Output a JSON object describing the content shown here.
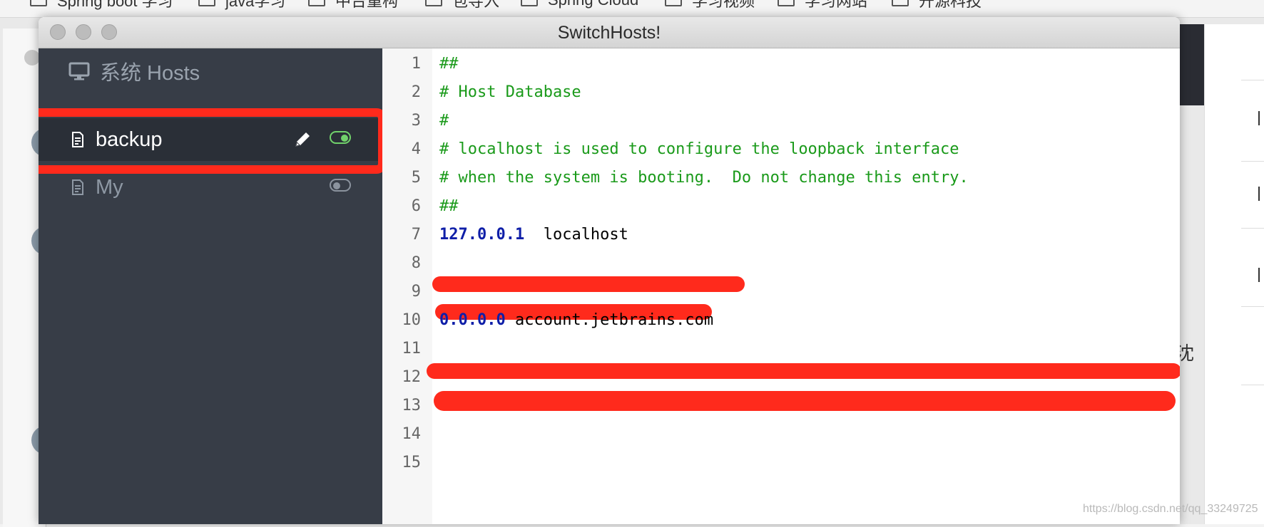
{
  "bookmarks": [
    {
      "label": "Spring boot 学习"
    },
    {
      "label": "java学习"
    },
    {
      "label": "中台重构"
    },
    {
      "label": "包导入"
    },
    {
      "label": "Spring Cloud"
    },
    {
      "label": "学习视频"
    },
    {
      "label": "学习网站"
    },
    {
      "label": "开源科技"
    }
  ],
  "window": {
    "title": "SwitchHosts!"
  },
  "sidebar": {
    "system_hosts_label": "系统 Hosts",
    "items": [
      {
        "label": "backup",
        "enabled": true,
        "selected": true
      },
      {
        "label": "My",
        "enabled": false,
        "selected": false
      }
    ]
  },
  "editor": {
    "line_numbers": [
      "1",
      "2",
      "3",
      "4",
      "5",
      "6",
      "7",
      "8",
      "9",
      "10",
      "11",
      "12",
      "13",
      "14",
      "15"
    ],
    "lines": [
      {
        "text": "##"
      },
      {
        "text": "# Host Database"
      },
      {
        "text": "#"
      },
      {
        "text": "# localhost is used to configure the loopback interface"
      },
      {
        "text": "# when the system is booting.  Do not change this entry."
      },
      {
        "text": "##"
      },
      {
        "ip": "127.0.0.1",
        "host": "  localhost"
      },
      {
        "redacted": true
      },
      {
        "redacted": true
      },
      {
        "ip": "0.0.0.0",
        "host": " account.jetbrains.com"
      },
      {
        "redacted": true
      },
      {
        "redacted": true
      }
    ]
  },
  "background": {
    "partial_glyph": "沈",
    "watermark": "https://blog.csdn.net/qq_33249725"
  },
  "colors": {
    "sidebar_bg": "#373d47",
    "selected_item_bg": "#2a2f37",
    "toggle_on": "#71d26b",
    "comment_green": "#1a9a1a",
    "ip_blue": "#0f1fa8",
    "annotation_red": "#ff2a1c"
  }
}
